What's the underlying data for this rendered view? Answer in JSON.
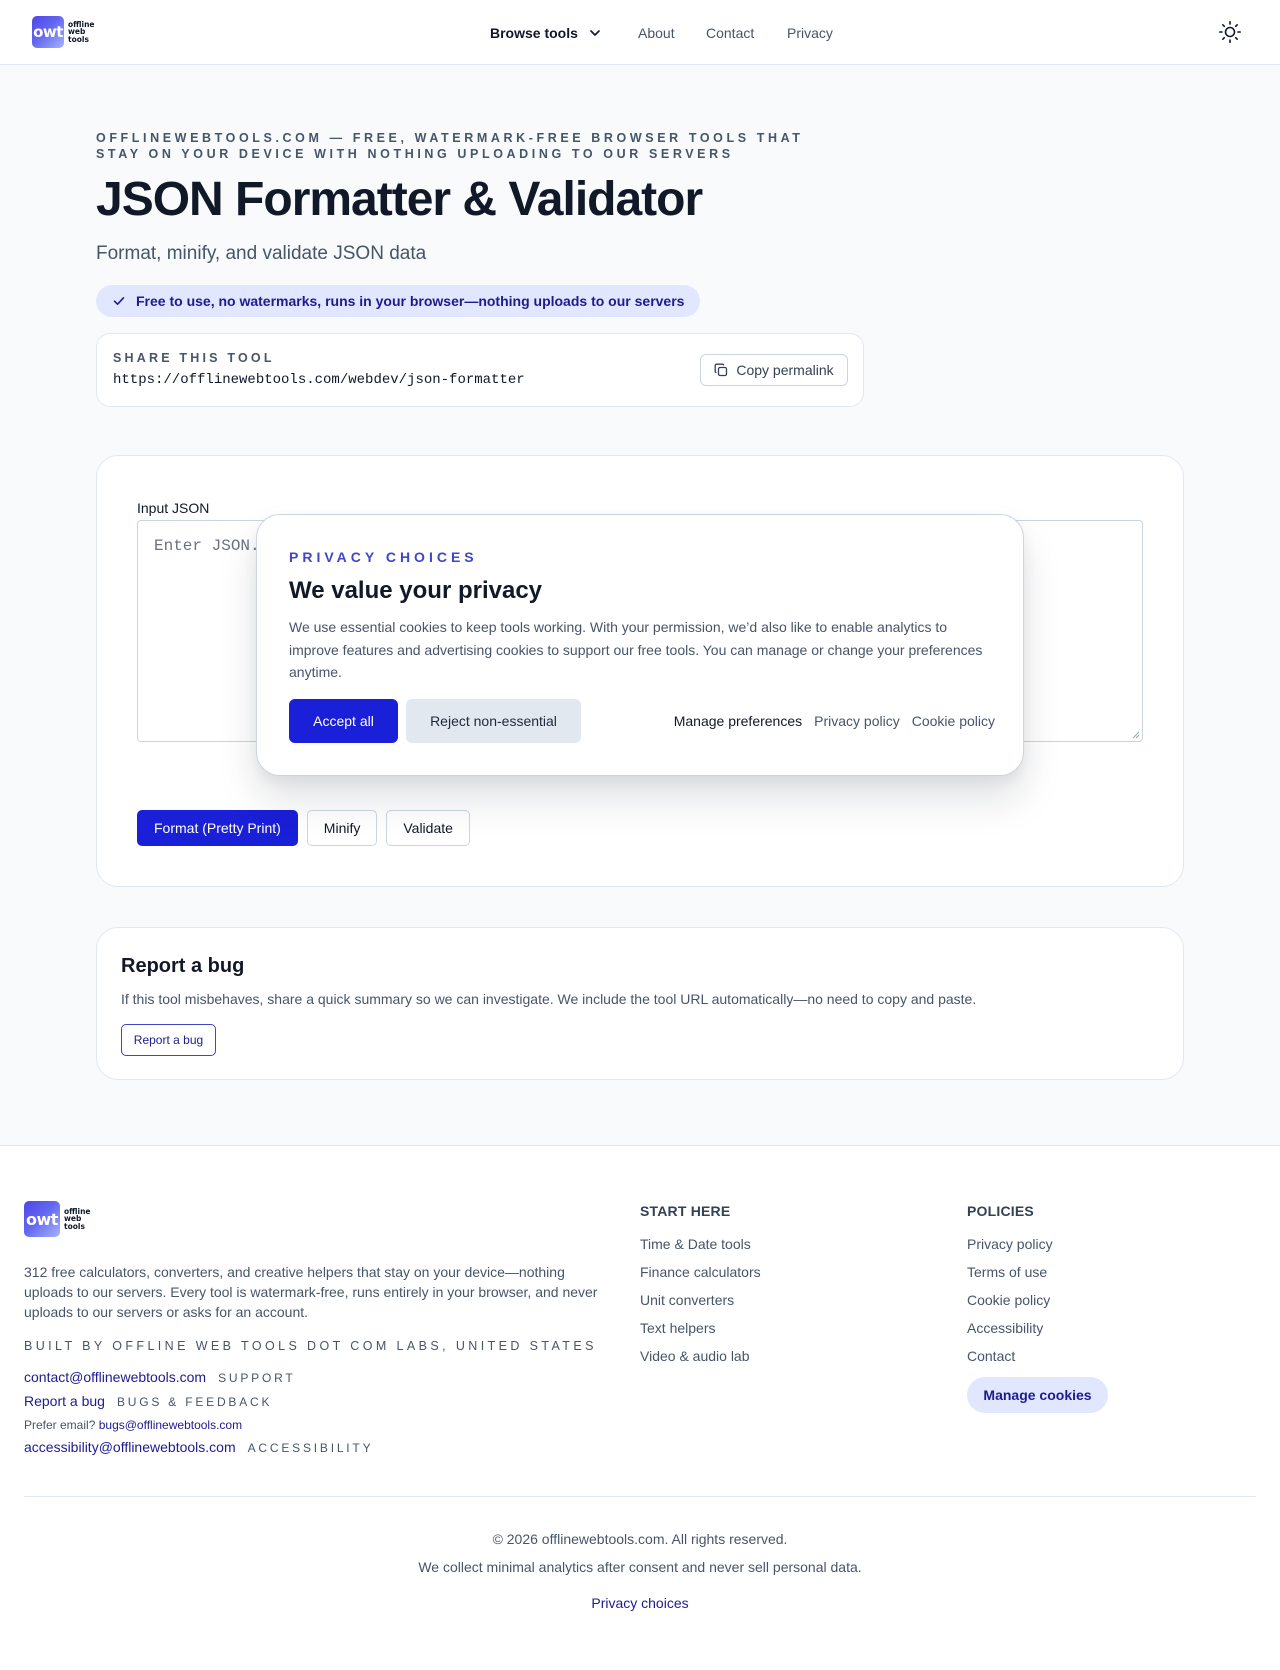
{
  "header": {
    "logo": {
      "mark": "owt",
      "words": [
        "offline",
        "web",
        "tools"
      ]
    },
    "nav": {
      "browse_label": "Browse tools",
      "links": [
        "About",
        "Contact",
        "Privacy"
      ]
    },
    "theme_icon": "sun-icon"
  },
  "hero": {
    "kicker": "OFFLINEWEBTOOLS.COM — FREE, WATERMARK-FREE BROWSER TOOLS THAT STAY ON YOUR DEVICE WITH NOTHING UPLOADING TO OUR SERVERS",
    "title": "JSON Formatter & Validator",
    "subtitle": "Format, minify, and validate JSON data",
    "badge": "Free to use, no watermarks, runs in your browser—nothing uploads to our servers"
  },
  "share": {
    "label": "SHARE THIS TOOL",
    "url": "https://offlinewebtools.com/webdev/json-formatter",
    "copy_label": "Copy permalink"
  },
  "tool": {
    "input_label": "Input JSON",
    "input_value": "",
    "input_placeholder": "Enter JSON...",
    "buttons": {
      "format": "Format (Pretty Print)",
      "minify": "Minify",
      "validate": "Validate"
    }
  },
  "privacy_modal": {
    "kicker": "PRIVACY CHOICES",
    "title": "We value your privacy",
    "text": "We use essential cookies to keep tools working. With your permission, we’d also like to enable analytics to improve features and advertising cookies to support our free tools. You can manage or change your preferences anytime.",
    "accept_label": "Accept all",
    "reject_label": "Reject non-essential",
    "manage_label": "Manage preferences",
    "privacy_policy_label": "Privacy policy",
    "cookie_policy_label": "Cookie policy"
  },
  "bug": {
    "title": "Report a bug",
    "text": "If this tool misbehaves, share a quick summary so we can investigate. We include the tool URL automatically—no need to copy and paste.",
    "button_label": "Report a bug"
  },
  "footer": {
    "description": "312 free calculators, converters, and creative helpers that stay on your device—nothing uploads to our servers. Every tool is watermark-free, runs entirely in your browser, and never uploads to our servers or asks for an account.",
    "built_by": "BUILT BY OFFLINE WEB TOOLS DOT COM LABS, UNITED STATES",
    "contacts": [
      {
        "link": "contact@offlinewebtools.com",
        "tag": "SUPPORT"
      },
      {
        "link": "Report a bug",
        "tag": "BUGS & FEEDBACK"
      },
      {
        "link": "accessibility@offlinewebtools.com",
        "tag": "ACCESSIBILITY"
      }
    ],
    "prefer_email_text": "Prefer email?",
    "prefer_email_link": "bugs@offlinewebtools.com",
    "start_here": {
      "title": "START HERE",
      "items": [
        "Time & Date tools",
        "Finance calculators",
        "Unit converters",
        "Text helpers",
        "Video & audio lab"
      ]
    },
    "policies": {
      "title": "POLICIES",
      "items": [
        "Privacy policy",
        "Terms of use",
        "Cookie policy",
        "Accessibility",
        "Contact"
      ],
      "manage_cookies_label": "Manage cookies"
    },
    "copyright": "© 2026 offlinewebtools.com. All rights reserved.",
    "analytics_note": "We collect minimal analytics after consent and never sell personal data.",
    "privacy_choices_label": "Privacy choices"
  },
  "colors": {
    "primary": "#1a1fd8",
    "accent_text": "#1e1b8f",
    "badge_bg": "#e0e7ff",
    "page_bg": "#f8fafc"
  }
}
